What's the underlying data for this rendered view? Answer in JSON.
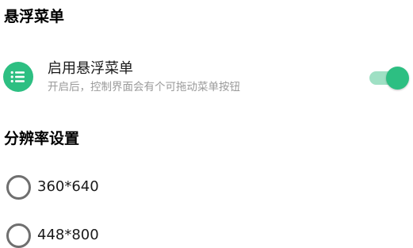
{
  "floating_menu_section": {
    "title": "悬浮菜单",
    "setting": {
      "icon": "list-menu-icon",
      "title": "启用悬浮菜单",
      "subtitle": "开启后，控制界面会有个可拖动菜单按钮",
      "enabled": true
    }
  },
  "resolution_section": {
    "title": "分辨率设置",
    "options": [
      {
        "label": "360*640",
        "selected": false
      },
      {
        "label": "448*800",
        "selected": false
      }
    ]
  },
  "colors": {
    "accent": "#2dbf82",
    "toggle_track": "#9fe0c4",
    "radio_border": "#6f6f6f",
    "subtitle": "#9a9a9a"
  }
}
